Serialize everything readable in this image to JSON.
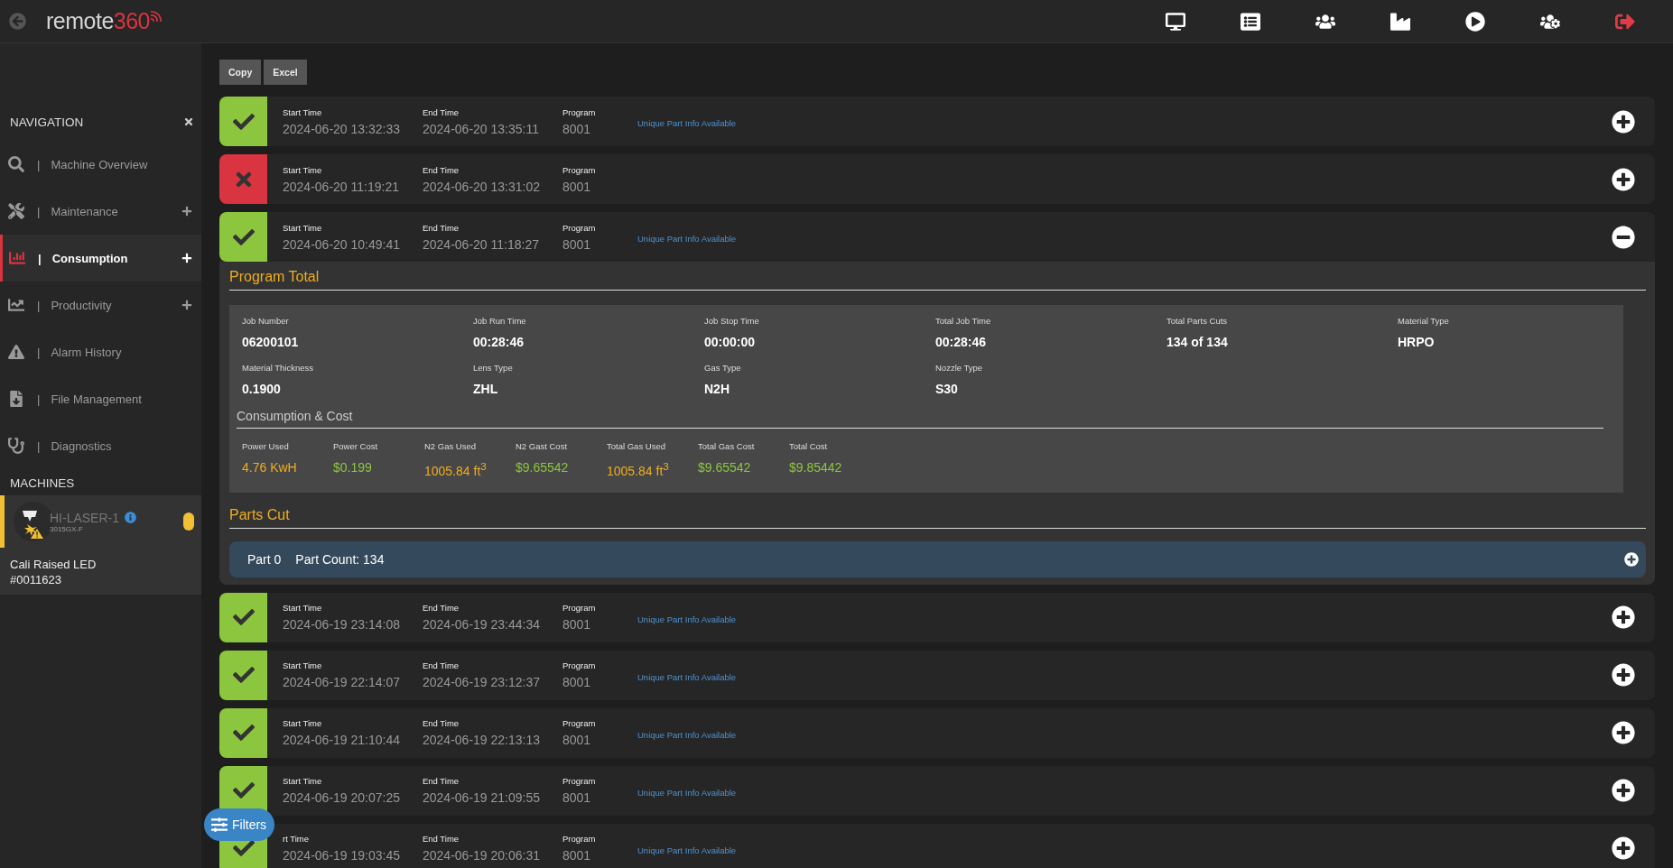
{
  "header": {
    "logo_text": "remote",
    "logo_accent": "360"
  },
  "sidebar": {
    "title": "NAVIGATION",
    "items": [
      {
        "separator": "|",
        "label": "Machine Overview",
        "selected": false,
        "expandable": false
      },
      {
        "separator": "|",
        "label": "Maintenance",
        "selected": false,
        "expandable": true
      },
      {
        "separator": "|",
        "label": "Consumption",
        "selected": true,
        "expandable": true
      },
      {
        "separator": "|",
        "label": "Productivity",
        "selected": false,
        "expandable": true
      },
      {
        "separator": "|",
        "label": "Alarm History",
        "selected": false,
        "expandable": false
      },
      {
        "separator": "|",
        "label": "File Management",
        "selected": false,
        "expandable": false
      },
      {
        "separator": "|",
        "label": "Diagnostics",
        "selected": false,
        "expandable": false
      }
    ],
    "machines_title": "MACHINES",
    "machine": {
      "name": "HI-LASER-1",
      "model": "3015GX-F",
      "color": "#f2c037",
      "job": "Cali Raised LED",
      "job_number": "#0011623"
    }
  },
  "export_buttons": [
    "Copy",
    "Excel"
  ],
  "jobs": [
    {
      "success": true,
      "start_label": "Start Time",
      "start": "2024-06-20 13:32:33",
      "end_label": "End Time",
      "end": "2024-06-20 13:35:11",
      "program_label": "Program",
      "program": "8001",
      "info": "Unique Part Info Available",
      "expanded": false
    },
    {
      "success": false,
      "start_label": "Start Time",
      "start": "2024-06-20 11:19:21",
      "end_label": "End Time",
      "end": "2024-06-20 13:31:02",
      "program_label": "Program",
      "program": "8001",
      "expanded": false
    },
    {
      "success": true,
      "start_label": "Start Time",
      "start": "2024-06-20 10:49:41",
      "end_label": "End Time",
      "end": "2024-06-20 11:18:27",
      "program_label": "Program",
      "program": "8001",
      "info": "Unique Part Info Available",
      "expanded": true,
      "detail": {
        "title": "Program Total",
        "fields": [
          {
            "label": "Job Number",
            "value": "06200101"
          },
          {
            "label": "Job Run Time",
            "value": "00:28:46"
          },
          {
            "label": "Job Stop Time",
            "value": "00:00:00"
          },
          {
            "label": "Total Job Time",
            "value": "00:28:46"
          },
          {
            "label": "Total Parts Cuts",
            "value": "134 of 134"
          },
          {
            "label": "Material Type",
            "value": "HRPO"
          },
          {
            "label": "Material Thickness",
            "value": "0.1900"
          },
          {
            "label": "Lens Type",
            "value": "ZHL"
          },
          {
            "label": "Gas Type",
            "value": "N2H"
          },
          {
            "label": "Nozzle Type",
            "value": "S30"
          }
        ],
        "consumption_title": "Consumption & Cost",
        "costs": [
          {
            "label": "Power Used",
            "value": "4.76 KwH",
            "kind": "amount"
          },
          {
            "label": "Power Cost",
            "value": "$0.199",
            "kind": "cost"
          },
          {
            "label": "N2 Gas Used",
            "value": "1005.84 ft$^{3}$",
            "kind": "amount"
          },
          {
            "label": "N2 Gast Cost",
            "value": "$9.65542",
            "kind": "cost"
          },
          {
            "label": "Total Gas Used",
            "value": "1005.84 ft$^{3}$",
            "kind": "amount"
          },
          {
            "label": "Total Gas Cost",
            "value": "$9.65542",
            "kind": "cost"
          },
          {
            "label": "Total Cost",
            "value": "$9.85442",
            "kind": "cost"
          }
        ],
        "parts_title": "Parts Cut",
        "parts": [
          {
            "name": "Part 0",
            "count": "Part Count: 134",
            "expanded": false
          }
        ]
      }
    },
    {
      "success": true,
      "start_label": "Start Time",
      "start": "2024-06-19 23:14:08",
      "end_label": "End Time",
      "end": "2024-06-19 23:44:34",
      "program_label": "Program",
      "program": "8001",
      "info": "Unique Part Info Available",
      "expanded": false
    },
    {
      "success": true,
      "start_label": "Start Time",
      "start": "2024-06-19 22:14:07",
      "end_label": "End Time",
      "end": "2024-06-19 23:12:37",
      "program_label": "Program",
      "program": "8001",
      "info": "Unique Part Info Available",
      "expanded": false
    },
    {
      "success": true,
      "start_label": "Start Time",
      "start": "2024-06-19 21:10:44",
      "end_label": "End Time",
      "end": "2024-06-19 22:13:13",
      "program_label": "Program",
      "program": "8001",
      "info": "Unique Part Info Available",
      "expanded": false
    },
    {
      "success": true,
      "start_label": "Start Time",
      "start": "2024-06-19 20:07:25",
      "end_label": "End Time",
      "end": "2024-06-19 21:09:55",
      "program_label": "Program",
      "program": "8001",
      "info": "Unique Part Info Available",
      "expanded": false
    },
    {
      "success": true,
      "start_label": "rt Time",
      "start": "2024-06-19 19:03:45",
      "end_label": "End Time",
      "end": "2024-06-19 20:06:31",
      "program_label": "Program",
      "program": "8001",
      "info": "Unique Part Info Available",
      "expanded": false
    }
  ],
  "filters_button": "Filters"
}
